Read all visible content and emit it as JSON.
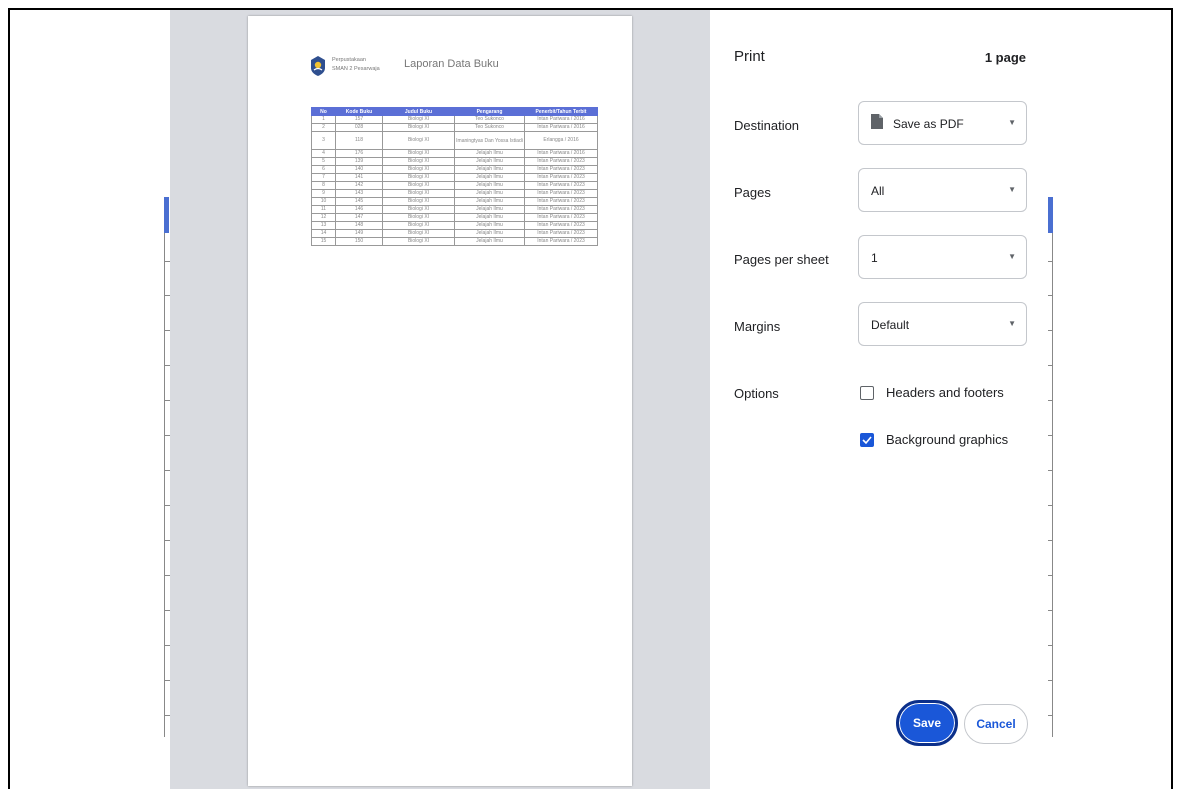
{
  "document": {
    "school_line1": "Perpustakaan",
    "school_line2": "SMAN 2 Pesarwaja",
    "title": "Laporan Data Buku",
    "table": {
      "headers": [
        "No",
        "Kode Buku",
        "Judul Buku",
        "Pengarang",
        "Penerbit/Tahun Terbit"
      ],
      "rows": [
        [
          "1",
          "157",
          "Biologi XI",
          "Teo Sukonco",
          "Intan Pariwara / 2016"
        ],
        [
          "2",
          "028",
          "Biologi XI",
          "Teo Sukonco",
          "Intan Pariwara / 2016"
        ],
        [
          "3",
          "118",
          "Biologi XI",
          "Imaningtyas Dan Yossa Istiadi",
          "Erlangga / 2016"
        ],
        [
          "4",
          "176",
          "Biologi XI",
          "Jelajah Ilmu",
          "Intan Pariwara / 2016"
        ],
        [
          "5",
          "139",
          "Biologi XI",
          "Jelajah Ilmu",
          "Intan Pariwara / 2023"
        ],
        [
          "6",
          "140",
          "Biologi XI",
          "Jelajah Ilmu",
          "Intan Pariwara / 2023"
        ],
        [
          "7",
          "141",
          "Biologi XI",
          "Jelajah Ilmu",
          "Intan Pariwara / 2023"
        ],
        [
          "8",
          "142",
          "Biologi XI",
          "Jelajah Ilmu",
          "Intan Pariwara / 2023"
        ],
        [
          "9",
          "143",
          "Biologi XI",
          "Jelajah Ilmu",
          "Intan Pariwara / 2023"
        ],
        [
          "10",
          "145",
          "Biologi XI",
          "Jelajah Ilmu",
          "Intan Pariwara / 2023"
        ],
        [
          "11",
          "146",
          "Biologi XI",
          "Jelajah Ilmu",
          "Intan Pariwara / 2023"
        ],
        [
          "12",
          "147",
          "Biologi XI",
          "Jelajah Ilmu",
          "Intan Pariwara / 2023"
        ],
        [
          "13",
          "148",
          "Biologi XI",
          "Jelajah Ilmu",
          "Intan Pariwara / 2023"
        ],
        [
          "14",
          "149",
          "Biologi XI",
          "Jelajah Ilmu",
          "Intan Pariwara / 2023"
        ],
        [
          "15",
          "150",
          "Biologi XI",
          "Jelajah Ilmu",
          "Intan Pariwara / 2023"
        ]
      ]
    }
  },
  "panel": {
    "title": "Print",
    "page_count": "1 page",
    "destination": {
      "label": "Destination",
      "value": "Save as PDF",
      "icon": "file-icon"
    },
    "pages": {
      "label": "Pages",
      "value": "All"
    },
    "pages_per_sheet": {
      "label": "Pages per sheet",
      "value": "1"
    },
    "margins": {
      "label": "Margins",
      "value": "Default"
    },
    "options": {
      "label": "Options",
      "headers_footers": {
        "label": "Headers and footers",
        "checked": false
      },
      "background_graphics": {
        "label": "Background graphics",
        "checked": true
      }
    },
    "save_label": "Save",
    "cancel_label": "Cancel"
  },
  "colors": {
    "accent": "#1a57d8",
    "table_header": "#5b6fd6",
    "preview_bg": "#d9dbe0"
  }
}
